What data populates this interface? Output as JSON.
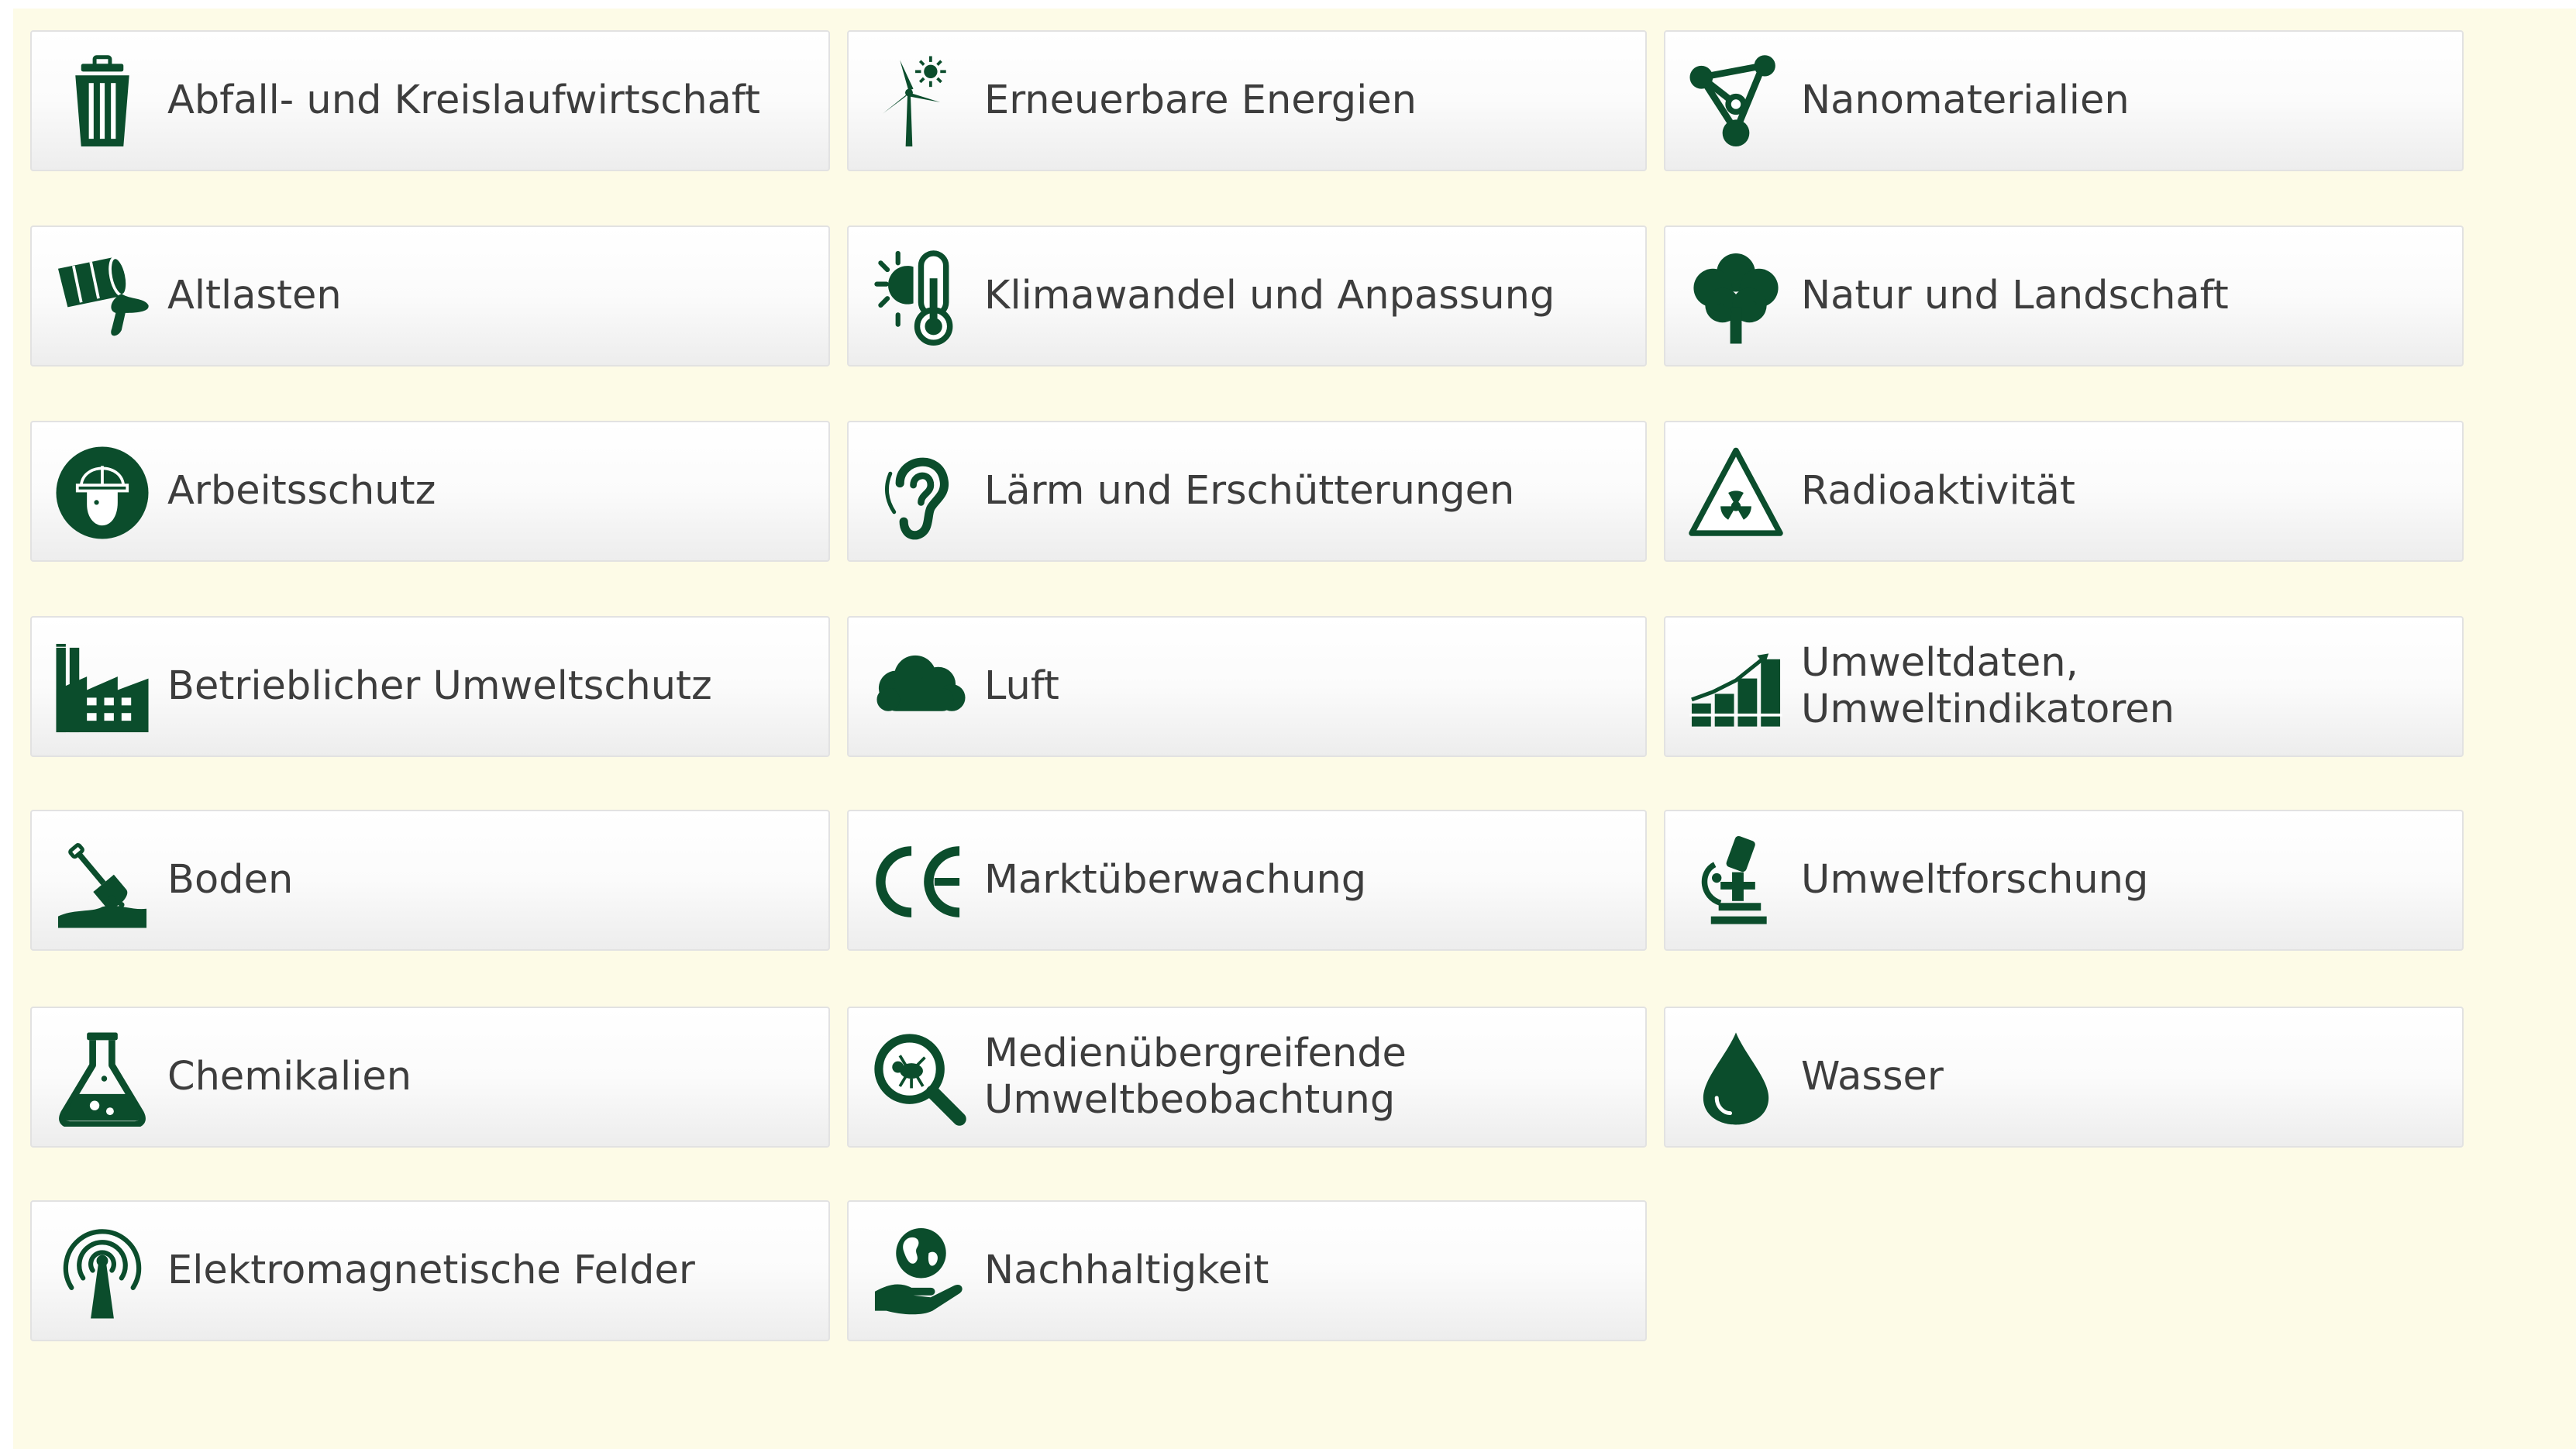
{
  "accent_color": "#0b4d2c",
  "topics": [
    {
      "label": "Abfall- und Kreislaufwirtschaft",
      "icon": "trash-bin-icon"
    },
    {
      "label": "Erneuerbare Energien",
      "icon": "wind-turbine-sun-icon"
    },
    {
      "label": "Nanomaterialien",
      "icon": "molecule-icon"
    },
    {
      "label": "Altlasten",
      "icon": "leaking-barrel-icon"
    },
    {
      "label": "Klimawandel und Anpassung",
      "icon": "sun-thermometer-icon"
    },
    {
      "label": "Natur und Landschaft",
      "icon": "tree-icon"
    },
    {
      "label": "Arbeitsschutz",
      "icon": "hard-hat-head-icon"
    },
    {
      "label": "Lärm und Erschütterungen",
      "icon": "ear-icon"
    },
    {
      "label": "Radioaktivität",
      "icon": "radiation-warning-icon"
    },
    {
      "label": "Betrieblicher Umweltschutz",
      "icon": "factory-icon"
    },
    {
      "label": "Luft",
      "icon": "cloud-icon"
    },
    {
      "label": "Umweltdaten,\nUmweltindikatoren",
      "icon": "bar-chart-icon"
    },
    {
      "label": "Boden",
      "icon": "shovel-soil-icon"
    },
    {
      "label": "Marktüberwachung",
      "icon": "ce-mark-icon"
    },
    {
      "label": "Umweltforschung",
      "icon": "microscope-icon"
    },
    {
      "label": "Chemikalien",
      "icon": "flask-icon"
    },
    {
      "label": "Medienübergreifende\nUmweltbeobachtung",
      "icon": "magnifier-bug-icon"
    },
    {
      "label": "Wasser",
      "icon": "water-drop-icon"
    },
    {
      "label": "Elektromagnetische Felder",
      "icon": "antenna-icon"
    },
    {
      "label": "Nachhaltigkeit",
      "icon": "globe-hand-icon"
    }
  ]
}
